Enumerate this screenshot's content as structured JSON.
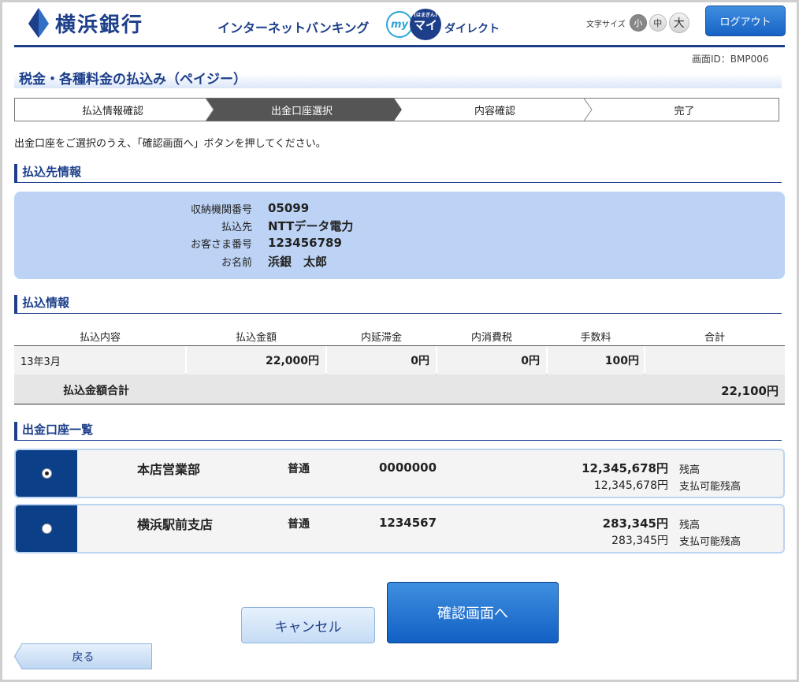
{
  "header": {
    "bank_name": "横浜銀行",
    "service_title": "インターネットバンキング",
    "my_logo_my": "my",
    "my_logo_mai": "マイ",
    "my_logo_small": "(はまぎん)",
    "my_logo_direct": "ダイレクト",
    "font_size_label": "文字サイズ",
    "font_size_small": "小",
    "font_size_medium": "中",
    "font_size_large": "大",
    "logout_label": "ログアウト"
  },
  "screen_id": "画面ID：BMP006",
  "page_title": "税金・各種料金の払込み（ペイジー）",
  "steps": [
    {
      "label": "払込情報確認",
      "active": false
    },
    {
      "label": "出金口座選択",
      "active": true
    },
    {
      "label": "内容確認",
      "active": false
    },
    {
      "label": "完了",
      "active": false
    }
  ],
  "instruction": "出金口座をご選択のうえ、「確認画面へ」ボタンを押してください。",
  "payee_section": {
    "heading": "払込先情報",
    "rows": [
      {
        "label": "収納機関番号",
        "value": "05099"
      },
      {
        "label": "払込先",
        "value": "NTTデータ電力"
      },
      {
        "label": "お客さま番号",
        "value": "123456789"
      },
      {
        "label": "お名前",
        "value": "浜銀　太郎"
      }
    ]
  },
  "payment_section": {
    "heading": "払込情報",
    "columns": [
      "払込内容",
      "払込金額",
      "内延滞金",
      "内消費税",
      "手数料",
      "合計"
    ],
    "row": {
      "content": "13年3月",
      "amount": "22,000円",
      "late_fee": "0円",
      "tax": "0円",
      "fee": "100円",
      "total": ""
    },
    "total_label": "払込金額合計",
    "total_value": "22,100円"
  },
  "account_section": {
    "heading": "出金口座一覧",
    "accounts": [
      {
        "branch": "本店営業部",
        "type": "普通",
        "number": "0000000",
        "balance": "12,345,678円",
        "balance_label": "残高",
        "available": "12,345,678円",
        "available_label": "支払可能残高",
        "selected": true
      },
      {
        "branch": "横浜駅前支店",
        "type": "普通",
        "number": "1234567",
        "balance": "283,345円",
        "balance_label": "残高",
        "available": "283,345円",
        "available_label": "支払可能残高",
        "selected": false
      }
    ]
  },
  "buttons": {
    "cancel": "キャンセル",
    "confirm": "確認画面へ",
    "back": "戻る"
  },
  "colors": {
    "brand": "#1d3f8a",
    "accent_blue": "#1762c4",
    "payee_bg": "#bdd3f5",
    "step_active": "#555555"
  }
}
